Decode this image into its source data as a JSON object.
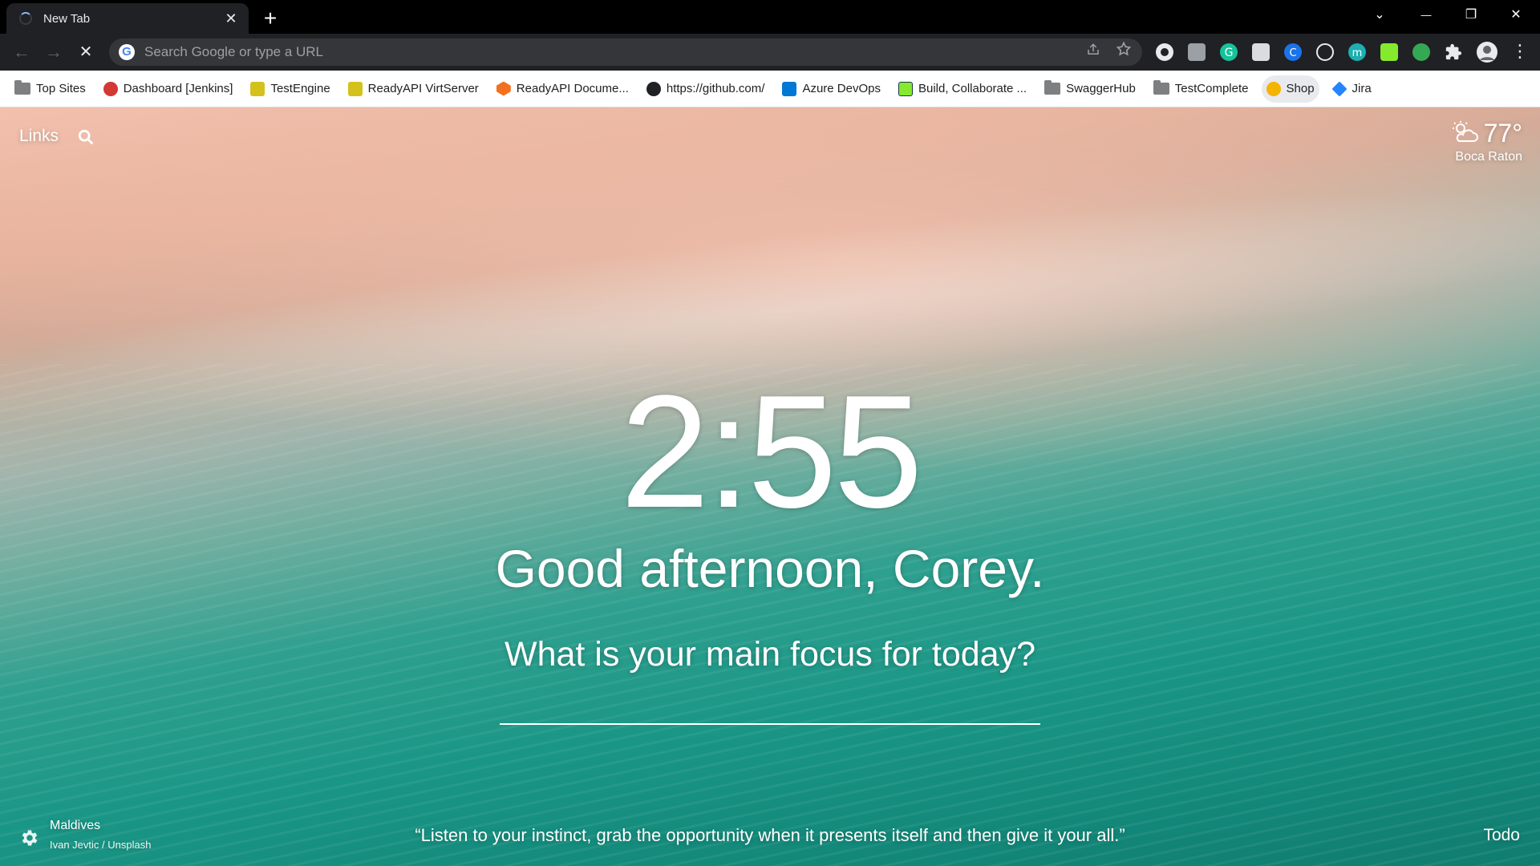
{
  "tab": {
    "title": "New Tab",
    "close": "✕"
  },
  "newtab": "+",
  "window": {
    "collapse": "⌄",
    "minimize": "—",
    "restore": "❐",
    "close": "✕"
  },
  "nav": {
    "back": "←",
    "forward": "→",
    "stop": "✕"
  },
  "omnibox": {
    "placeholder": "Search Google or type a URL",
    "value": "",
    "g": "G"
  },
  "bookmarks": [
    {
      "label": "Top Sites",
      "icon": "folder-icon"
    },
    {
      "label": "Dashboard [Jenkins]",
      "icon": "jenkins-icon"
    },
    {
      "label": "TestEngine",
      "icon": "testengine-icon"
    },
    {
      "label": "ReadyAPI VirtServer",
      "icon": "readyapi-icon"
    },
    {
      "label": "ReadyAPI Docume...",
      "icon": "smartbear-icon"
    },
    {
      "label": "https://github.com/",
      "icon": "github-icon"
    },
    {
      "label": "Azure DevOps",
      "icon": "azure-devops-icon"
    },
    {
      "label": "Build, Collaborate ...",
      "icon": "swagger-icon"
    },
    {
      "label": "SwaggerHub",
      "icon": "folder-icon"
    },
    {
      "label": "TestComplete",
      "icon": "folder-icon"
    },
    {
      "label": "Shop",
      "icon": "shop-icon"
    },
    {
      "label": "Jira",
      "icon": "jira-icon"
    }
  ],
  "momentum": {
    "links": "Links",
    "weather": {
      "temp": "77°",
      "location": "Boca Raton"
    },
    "clock": "2:55",
    "greeting": "Good afternoon, Corey.",
    "focus_question": "What is your main focus for today?",
    "focus_value": "",
    "photo_location": "Maldives",
    "photo_credit": "Ivan Jevtic / Unsplash",
    "quote": "“Listen to your instinct, grab the opportunity when it presents itself and then give it your all.”",
    "todo": "Todo"
  },
  "colors": {
    "accent": "#8ab4f8",
    "toolbar": "#202124",
    "omnibox": "#35363a"
  }
}
